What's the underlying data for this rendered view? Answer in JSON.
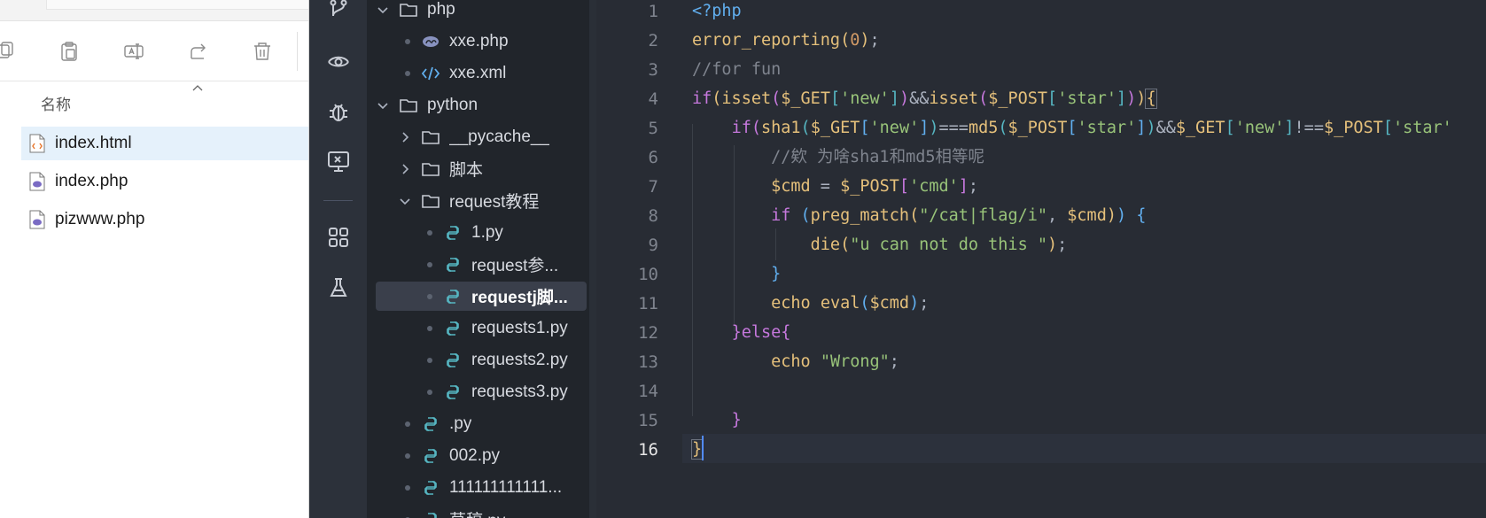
{
  "explorer": {
    "column_header": "名称",
    "files": [
      {
        "name": "index.html",
        "type": "html",
        "selected": true
      },
      {
        "name": "index.php",
        "type": "php",
        "selected": false
      },
      {
        "name": "pizwww.php",
        "type": "php",
        "selected": false
      }
    ],
    "toolbar_icons": [
      "copy-icon",
      "paste-icon",
      "rename-icon",
      "share-icon",
      "delete-icon"
    ]
  },
  "activity_bar": {
    "icons": [
      "source-control-icon",
      "watch-icon",
      "debug-icon",
      "remote-explorer-icon",
      "extensions-icon",
      "testing-icon"
    ]
  },
  "tree": {
    "items": [
      {
        "label": "php",
        "kind": "folder",
        "expanded": true,
        "level": 0
      },
      {
        "label": "xxe.php",
        "kind": "php",
        "level": 1
      },
      {
        "label": "xxe.xml",
        "kind": "xml",
        "level": 1
      },
      {
        "label": "python",
        "kind": "folder",
        "expanded": true,
        "level": 0
      },
      {
        "label": "__pycache__",
        "kind": "folder",
        "expanded": false,
        "level": 1
      },
      {
        "label": "脚本",
        "kind": "folder",
        "expanded": false,
        "level": 1
      },
      {
        "label": "request教程",
        "kind": "folder",
        "expanded": true,
        "level": 1
      },
      {
        "label": "1.py",
        "kind": "py",
        "level": 2
      },
      {
        "label": "request参...",
        "kind": "py",
        "level": 2
      },
      {
        "label": "requestj脚...",
        "kind": "py",
        "level": 2,
        "active": true
      },
      {
        "label": "requests1.py",
        "kind": "py",
        "level": 2
      },
      {
        "label": "requests2.py",
        "kind": "py",
        "level": 2
      },
      {
        "label": "requests3.py",
        "kind": "py",
        "level": 2
      },
      {
        "label": ".py",
        "kind": "py",
        "level": 1
      },
      {
        "label": "002.py",
        "kind": "py",
        "level": 1
      },
      {
        "label": "111111111111...",
        "kind": "py",
        "level": 1
      },
      {
        "label": "草稿.py",
        "kind": "py",
        "level": 1
      }
    ]
  },
  "editor": {
    "current_line": 16,
    "line_numbers": [
      "1",
      "2",
      "3",
      "4",
      "5",
      "6",
      "7",
      "8",
      "9",
      "10",
      "11",
      "12",
      "13",
      "14",
      "15",
      "16"
    ],
    "lines": [
      [
        [
          "c-tag",
          "<?php"
        ]
      ],
      [
        [
          "c-fn",
          "error_reporting"
        ],
        [
          "c-p1",
          "("
        ],
        [
          "c-num",
          "0"
        ],
        [
          "c-p1",
          ")"
        ],
        [
          "c-pun",
          ";"
        ]
      ],
      [
        [
          "c-com",
          "//for fun"
        ]
      ],
      [
        [
          "c-kw",
          "if"
        ],
        [
          "c-p1",
          "("
        ],
        [
          "c-fn",
          "isset"
        ],
        [
          "c-p2",
          "("
        ],
        [
          "c-var",
          "$_GET"
        ],
        [
          "c-p3",
          "["
        ],
        [
          "c-str",
          "'new'"
        ],
        [
          "c-p3",
          "]"
        ],
        [
          "c-p2",
          ")"
        ],
        [
          "c-op",
          "&&"
        ],
        [
          "c-fn",
          "isset"
        ],
        [
          "c-p2",
          "("
        ],
        [
          "c-var",
          "$_POST"
        ],
        [
          "c-p3",
          "["
        ],
        [
          "c-str",
          "'star'"
        ],
        [
          "c-p3",
          "]"
        ],
        [
          "c-p2",
          ")"
        ],
        [
          "c-p1",
          ")"
        ],
        [
          "c-p1 bm",
          "{"
        ]
      ],
      [
        [
          "c-pun",
          "    "
        ],
        [
          "c-kw",
          "if"
        ],
        [
          "c-p2",
          "("
        ],
        [
          "c-fn",
          "sha1"
        ],
        [
          "c-p3",
          "("
        ],
        [
          "c-var",
          "$_GET"
        ],
        [
          "c-brk",
          "["
        ],
        [
          "c-str",
          "'new'"
        ],
        [
          "c-brk",
          "]"
        ],
        [
          "c-p3",
          ")"
        ],
        [
          "c-op",
          "==="
        ],
        [
          "c-fn",
          "md5"
        ],
        [
          "c-p3",
          "("
        ],
        [
          "c-var",
          "$_POST"
        ],
        [
          "c-brk",
          "["
        ],
        [
          "c-str",
          "'star'"
        ],
        [
          "c-brk",
          "]"
        ],
        [
          "c-p3",
          ")"
        ],
        [
          "c-op",
          "&&"
        ],
        [
          "c-var",
          "$_GET"
        ],
        [
          "c-p3",
          "["
        ],
        [
          "c-str",
          "'new'"
        ],
        [
          "c-p3",
          "]"
        ],
        [
          "c-op",
          "!=="
        ],
        [
          "c-var",
          "$_POST"
        ],
        [
          "c-p3",
          "["
        ],
        [
          "c-str",
          "'star'"
        ]
      ],
      [
        [
          "c-pun",
          "        "
        ],
        [
          "c-com",
          "//欸 为啥sha1和md5相等呢"
        ]
      ],
      [
        [
          "c-pun",
          "        "
        ],
        [
          "c-var",
          "$cmd"
        ],
        [
          "c-op",
          " = "
        ],
        [
          "c-var",
          "$_POST"
        ],
        [
          "c-p2",
          "["
        ],
        [
          "c-str",
          "'cmd'"
        ],
        [
          "c-p2",
          "]"
        ],
        [
          "c-pun",
          ";"
        ]
      ],
      [
        [
          "c-pun",
          "        "
        ],
        [
          "c-kw",
          "if"
        ],
        [
          "c-pun",
          " "
        ],
        [
          "c-brk",
          "("
        ],
        [
          "c-fn",
          "preg_match"
        ],
        [
          "c-p1",
          "("
        ],
        [
          "c-str",
          "\"/cat|flag/i\""
        ],
        [
          "c-pun",
          ", "
        ],
        [
          "c-var",
          "$cmd"
        ],
        [
          "c-p1",
          ")"
        ],
        [
          "c-brk",
          ")"
        ],
        [
          "c-pun",
          " "
        ],
        [
          "c-brk",
          "{"
        ]
      ],
      [
        [
          "c-pun",
          "            "
        ],
        [
          "c-fn",
          "die"
        ],
        [
          "c-p1",
          "("
        ],
        [
          "c-str",
          "\"u can not do this \""
        ],
        [
          "c-p1",
          ")"
        ],
        [
          "c-pun",
          ";"
        ]
      ],
      [
        [
          "c-pun",
          "        "
        ],
        [
          "c-brk",
          "}"
        ]
      ],
      [
        [
          "c-pun",
          "        "
        ],
        [
          "c-ech",
          "echo"
        ],
        [
          "c-pun",
          " "
        ],
        [
          "c-fn",
          "eval"
        ],
        [
          "c-brk",
          "("
        ],
        [
          "c-var",
          "$cmd"
        ],
        [
          "c-brk",
          ")"
        ],
        [
          "c-pun",
          ";"
        ]
      ],
      [
        [
          "c-pun",
          "    "
        ],
        [
          "c-p2",
          "}"
        ],
        [
          "c-kw",
          "else"
        ],
        [
          "c-p2",
          "{"
        ]
      ],
      [
        [
          "c-pun",
          "        "
        ],
        [
          "c-ech",
          "echo"
        ],
        [
          "c-pun",
          " "
        ],
        [
          "c-str",
          "\"Wrong\""
        ],
        [
          "c-pun",
          ";"
        ]
      ],
      [
        [
          "c-pun",
          ""
        ]
      ],
      [
        [
          "c-pun",
          "    "
        ],
        [
          "c-p2",
          "}"
        ]
      ],
      [
        [
          "c-p1 bm",
          "}"
        ]
      ]
    ]
  }
}
